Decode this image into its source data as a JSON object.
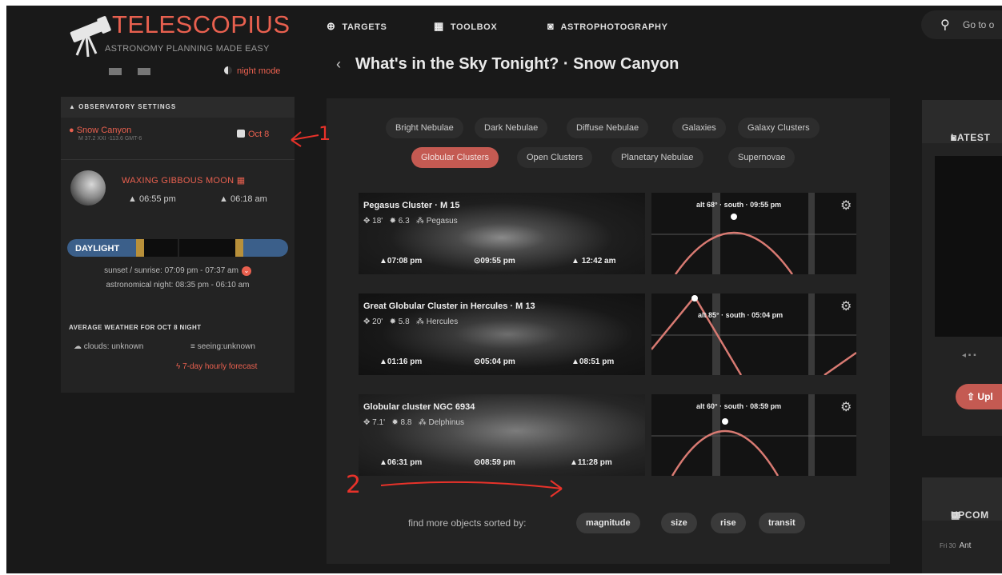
{
  "app": {
    "logo_title": "TELESCOPIUS",
    "logo_subtitle": "ASTRONOMY PLANNING MADE EASY",
    "night_mode": "night mode"
  },
  "nav": {
    "targets": "TARGETS",
    "toolbox": "TOOLBOX",
    "astrophotography": "ASTROPHOTOGRAPHY",
    "search_placeholder": "Go to o"
  },
  "page": {
    "back": "‹",
    "title": "What's in the Sky Tonight? · Snow Canyon"
  },
  "observatory": {
    "header": "OBSERVATORY SETTINGS",
    "location": "Snow Canyon",
    "coords": "M 37.2 XXI -113.6 GMT-6",
    "date": "Oct 8",
    "moon_label": "WAXING GIBBOUS MOON",
    "moon_rise": "06:55 pm",
    "moon_set": "06:18 am",
    "daylight": "DAYLIGHT",
    "sun_line": "sunset / sunrise: 07:09 pm - 07:37 am",
    "astro_night": "astronomical night: 08:35 pm - 06:10 am",
    "weather_header": "AVERAGE WEATHER FOR OCT 8 NIGHT",
    "clouds": "clouds: unknown",
    "seeing": "seeing:unknown",
    "forecast": "7-day hourly forecast"
  },
  "categories": {
    "row1": [
      "Bright Nebulae",
      "Dark Nebulae",
      "Diffuse Nebulae",
      "Galaxies",
      "Galaxy Clusters"
    ],
    "row2": [
      "Globular Clusters",
      "Open Clusters",
      "Planetary Nebulae",
      "Supernovae"
    ],
    "active": "Globular Clusters"
  },
  "objects": [
    {
      "name": "Pegasus Cluster · M 15",
      "size": "18'",
      "magnitude": "6.3",
      "constellation": "Pegasus",
      "rise": "07:08 pm",
      "transit": "09:55 pm",
      "set": "12:42 am",
      "altitude": "alt 68° · south · 09:55 pm"
    },
    {
      "name": "Great Globular Cluster in Hercules · M 13",
      "size": "20'",
      "magnitude": "5.8",
      "constellation": "Hercules",
      "rise": "01:16 pm",
      "transit": "05:04 pm",
      "set": "08:51 pm",
      "altitude": "alt 85° · south · 05:04 pm"
    },
    {
      "name": "Globular cluster NGC 6934",
      "size": "7.1'",
      "magnitude": "8.8",
      "constellation": "Delphinus",
      "rise": "06:31 pm",
      "transit": "08:59 pm",
      "set": "11:28 pm",
      "altitude": "alt 60° · south · 08:59 pm"
    }
  ],
  "sort": {
    "label": "find more objects sorted by:",
    "options": [
      "magnitude",
      "size",
      "rise",
      "transit"
    ]
  },
  "right": {
    "latest_header": "LATEST",
    "upload": "Upl",
    "upcoming_header": "UPCOM",
    "upcoming_date": "Fri 30",
    "upcoming_text": "Ant"
  },
  "annotations": {
    "mark1": "1",
    "mark2": "2"
  },
  "colors": {
    "accent": "#e8604f",
    "active_chip": "#c45a52",
    "daylight": "#3b5f8a",
    "twilight": "#b8903a",
    "annotation": "#e8322a"
  }
}
